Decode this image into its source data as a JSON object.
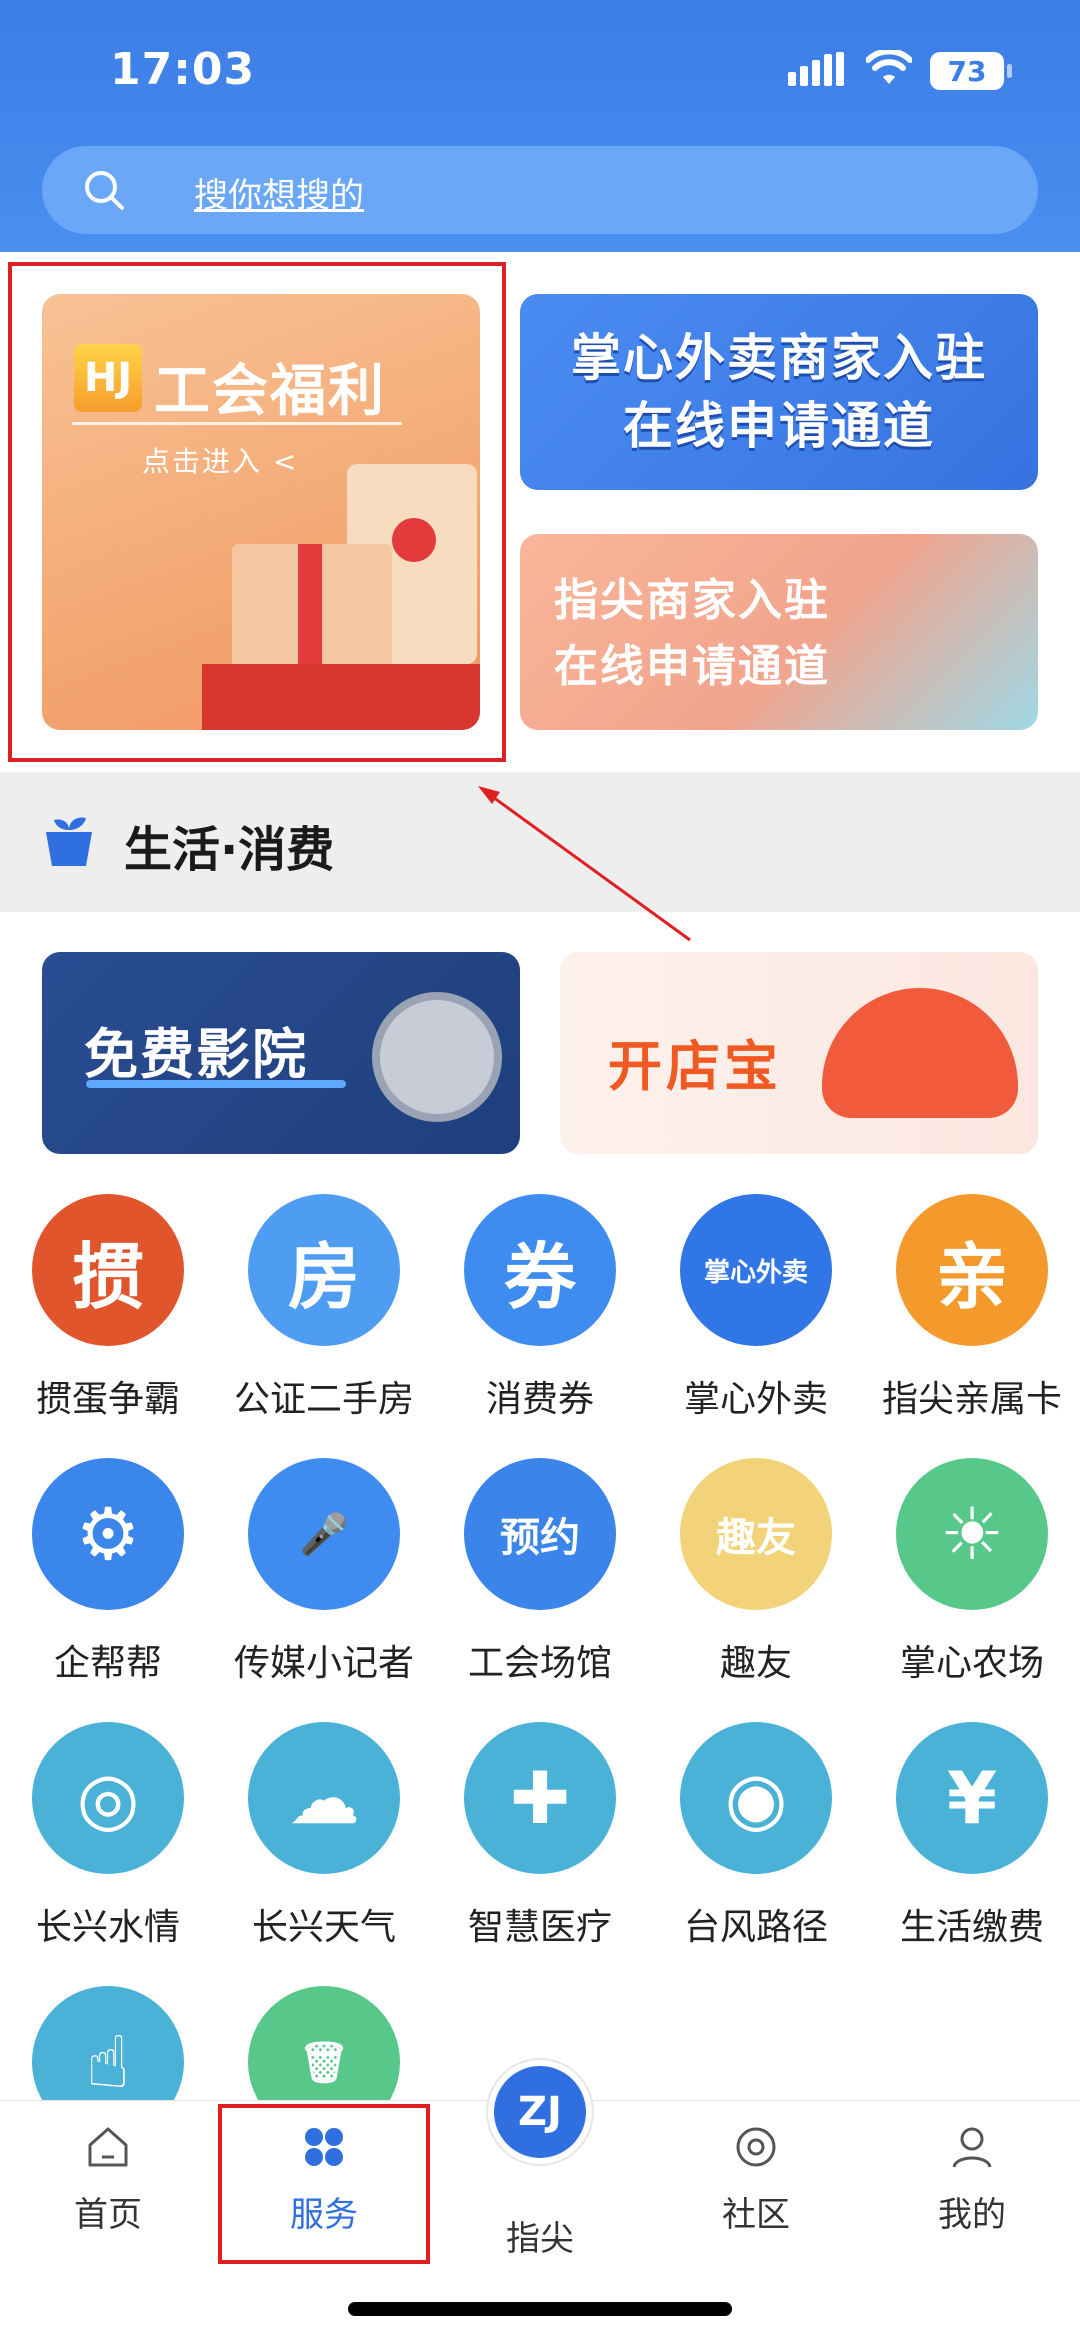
{
  "status": {
    "time": "17:03",
    "battery": "73"
  },
  "search": {
    "placeholder": "搜你想搜的"
  },
  "banners": {
    "union": {
      "logo": "HJ",
      "title": "工会福利",
      "subtitle": "点击进入 <"
    },
    "waimai": {
      "line1": "掌心外卖商家入驻",
      "line2": "在线申请通道"
    },
    "zhijian": {
      "line1": "指尖商家入驻",
      "line2": "在线申请通道"
    },
    "cinema": {
      "title": "免费影院"
    },
    "shop": {
      "title": "开店宝"
    }
  },
  "section": {
    "title": "生活·消费"
  },
  "grid": [
    {
      "label": "掼蛋争霸",
      "glyph": "掼",
      "color": "#e0552b"
    },
    {
      "label": "公证二手房",
      "glyph": "房",
      "color": "#4f9df2"
    },
    {
      "label": "消费券",
      "glyph": "券",
      "color": "#3f8cf0"
    },
    {
      "label": "掌心外卖",
      "glyph": "掌心外卖",
      "color": "#3176e6"
    },
    {
      "label": "指尖亲属卡",
      "glyph": "亲",
      "color": "#f49a2c"
    },
    {
      "label": "企帮帮",
      "glyph": "⚙",
      "color": "#3b86ea"
    },
    {
      "label": "传媒小记者",
      "glyph": "🎤",
      "color": "#3f8cf0"
    },
    {
      "label": "工会场馆",
      "glyph": "预约",
      "color": "#3a84ea"
    },
    {
      "label": "趣友",
      "glyph": "趣友",
      "color": "#f3d37a"
    },
    {
      "label": "掌心农场",
      "glyph": "☀",
      "color": "#58c88a"
    },
    {
      "label": "长兴水情",
      "glyph": "◎",
      "color": "#4ab2d6"
    },
    {
      "label": "长兴天气",
      "glyph": "☁",
      "color": "#4ab2d6"
    },
    {
      "label": "智慧医疗",
      "glyph": "✚",
      "color": "#4ab2d6"
    },
    {
      "label": "台风路径",
      "glyph": "◉",
      "color": "#4ab2d6"
    },
    {
      "label": "生活缴费",
      "glyph": "¥",
      "color": "#4ab2d6"
    },
    {
      "label": "",
      "glyph": "☝",
      "color": "#4ab2d6"
    },
    {
      "label": "",
      "glyph": "🗑",
      "color": "#58c88a"
    }
  ],
  "tabbar": {
    "home": "首页",
    "service": "服务",
    "zhijian": "指尖",
    "community": "社区",
    "mine": "我的"
  },
  "colors": {
    "primary": "#2f6fe0",
    "highlight": "#e02020"
  },
  "icons": [
    "search-icon",
    "signal-icon",
    "wifi-icon",
    "battery-icon",
    "gift-icon",
    "cinema-reel-icon",
    "shop-icon",
    "home-icon",
    "service-grid-icon",
    "zhijian-logo-icon",
    "community-icon",
    "profile-icon"
  ]
}
